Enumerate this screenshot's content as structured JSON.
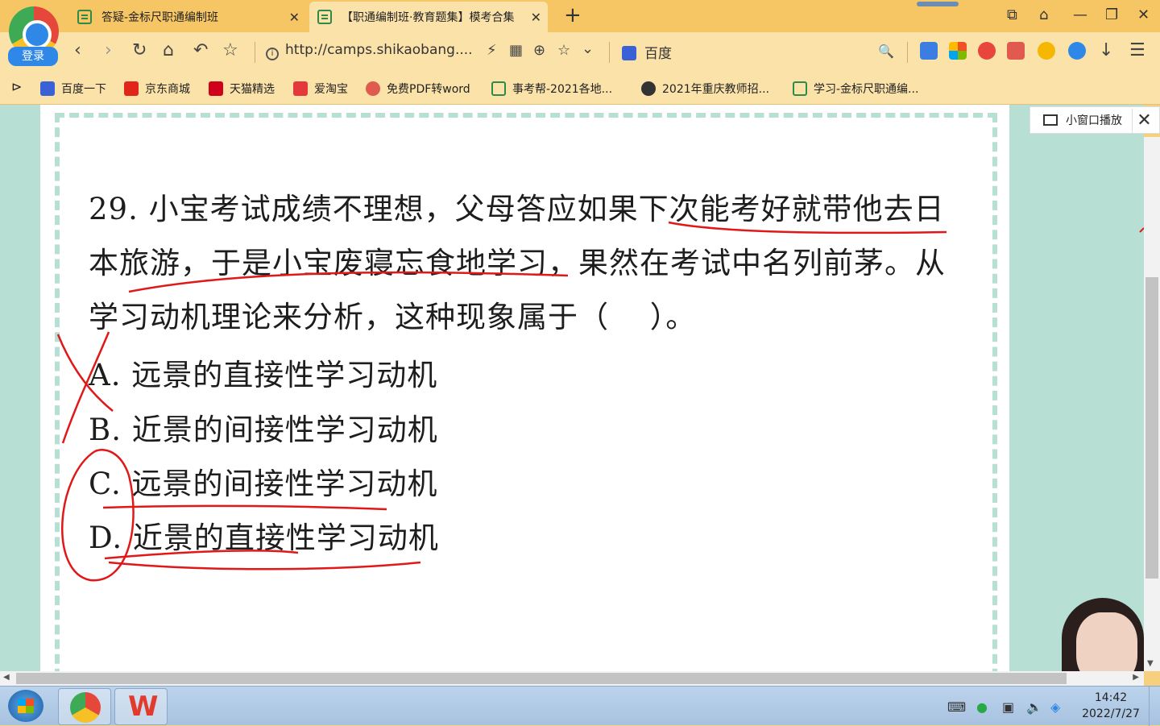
{
  "browser": {
    "login_label": "登录",
    "tabs": [
      {
        "title": "答疑-金标尺职通编制班",
        "close": "✕"
      },
      {
        "title": "【职通编制班·教育题集】模考合集",
        "close": "✕"
      }
    ],
    "new_tab": "+",
    "window_controls": {
      "minimize": "—",
      "restore": "❐",
      "close": "✕",
      "pin": "⧉",
      "skin": "⌂"
    },
    "nav": {
      "back": "‹",
      "forward": "›",
      "reload": "↻",
      "home": "⌂",
      "undo": "↶",
      "favorite": "☆"
    },
    "url": "http://camps.shikaobang....",
    "url_icons": {
      "lightning": "⚡",
      "qr": "▦",
      "zoom": "⊕",
      "star": "☆",
      "dropdown": "⌄"
    },
    "search_engine": "百度",
    "search_icon": "🔍",
    "menu_icon": "☰",
    "download_icon": "↓",
    "bookmarks": [
      {
        "label": "百度一下",
        "color": "#3a62d6"
      },
      {
        "label": "京东商城",
        "color": "#e1251b"
      },
      {
        "label": "天猫精选",
        "color": "#d0021b"
      },
      {
        "label": "爱淘宝",
        "color": "#e4393c"
      },
      {
        "label": "免费PDF转word",
        "color": "#e05a4f"
      },
      {
        "label": "事考帮-2021各地...",
        "color": "#2f8a4a"
      },
      {
        "label": "2021年重庆教师招...",
        "color": "#333333"
      },
      {
        "label": "学习-金标尺职通编...",
        "color": "#2f8a4a"
      }
    ],
    "bookmark_toggle": "⊳"
  },
  "content": {
    "question_text": "29. 小宝考试成绩不理想，父母答应如果下次能考好就带他去日本旅游，于是小宝废寝忘食地学习，果然在考试中名列前茅。从学习动机理论来分析，这种现象属于（　 ）。",
    "options": {
      "a": "A. 远景的直接性学习动机",
      "b": "B. 近景的间接性学习动机",
      "c": "C. 远景的间接性学习动机",
      "d": "D. 近景的直接性学习动机"
    },
    "mini_player_label": "小窗口播放",
    "mini_player_close": "✕"
  },
  "taskbar": {
    "time": "14:42",
    "date": "2022/7/27",
    "tray_icons": [
      "keyboard-icon",
      "wechat-icon",
      "network-icon",
      "volume-icon",
      "update-icon"
    ]
  },
  "colors": {
    "tab_bar": "#f7c664",
    "toolbar": "#fbe2a9",
    "content_bg": "#b8dfd3",
    "annotation_red": "#e01818"
  }
}
